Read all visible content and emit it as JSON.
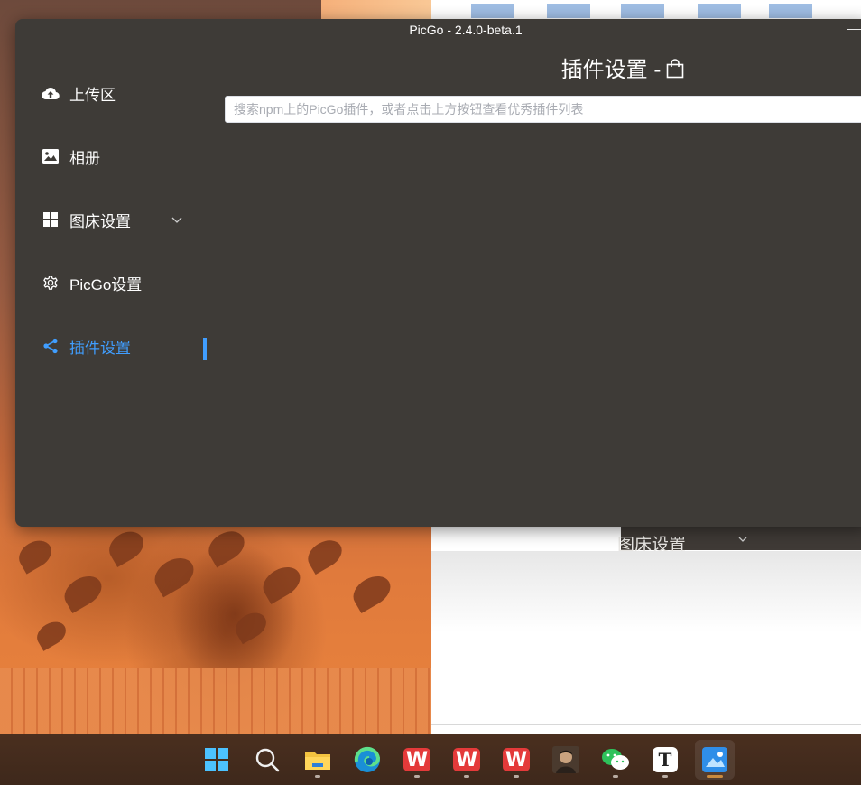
{
  "window": {
    "title": "PicGo - 2.4.0-beta.1"
  },
  "sidebar": {
    "items": [
      {
        "label": "上传区",
        "icon": "cloud-upload-icon"
      },
      {
        "label": "相册",
        "icon": "picture-icon"
      },
      {
        "label": "图床设置",
        "icon": "grid-icon",
        "expandable": true
      },
      {
        "label": "PicGo设置",
        "icon": "gear-icon"
      },
      {
        "label": "插件设置",
        "icon": "share-icon",
        "active": true
      }
    ],
    "info_icon": "info-icon"
  },
  "main": {
    "title": "插件设置 -",
    "title_icon": "shopping-bag-icon",
    "search": {
      "placeholder": "搜索npm上的PicGo插件，或者点击上方按钮查看优秀插件列表",
      "value": ""
    }
  },
  "background_window": {
    "visible_label": "图床设置"
  },
  "taskbar": {
    "apps": [
      {
        "name": "windows-start-icon"
      },
      {
        "name": "search-icon"
      },
      {
        "name": "file-explorer-icon"
      },
      {
        "name": "edge-icon"
      },
      {
        "name": "wps-icon"
      },
      {
        "name": "wps-icon"
      },
      {
        "name": "wps-icon"
      },
      {
        "name": "user-avatar-icon"
      },
      {
        "name": "wechat-icon"
      },
      {
        "name": "typora-icon"
      },
      {
        "name": "picgo-icon"
      }
    ]
  },
  "colors": {
    "app_background": "#3e3b37",
    "accent": "#409eff",
    "text": "#ffffff",
    "wps_red": "#e43a3a",
    "wechat_green": "#2ec25b"
  }
}
